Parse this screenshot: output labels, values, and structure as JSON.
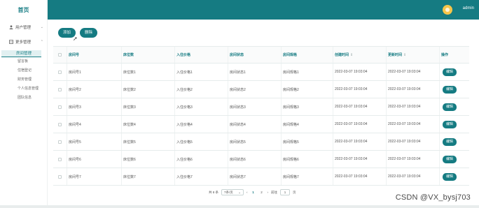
{
  "sidebar": {
    "brand": "首页",
    "groups": [
      {
        "label": "用户管理",
        "icon": "user-icon"
      },
      {
        "label": "更多管理",
        "icon": "grid-icon"
      }
    ],
    "active": "房间管理",
    "items": [
      "留言板",
      "住宿登记",
      "财务管理",
      "个人信息管理",
      "团队信息"
    ]
  },
  "header": {
    "username": "admin",
    "avatar_icon": "avatar-icon",
    "bg_color": "#157b82"
  },
  "toolbar": {
    "add_label": "添加",
    "delete_label": "删除"
  },
  "table": {
    "columns": [
      "房间号",
      "床位数",
      "入住价格",
      "房间状态",
      "房间规格",
      "创建时间",
      "更新时间",
      "操作"
    ],
    "edit_label": "编辑",
    "rows": [
      [
        "房间号1",
        "床位数1",
        "入住价格1",
        "房间状态1",
        "房间规格1",
        "2022-03-07 19:03:04",
        "2022-03-07 19:03:04"
      ],
      [
        "房间号2",
        "床位数2",
        "入住价格2",
        "房间状态2",
        "房间规格2",
        "2022-03-07 19:03:04",
        "2022-03-07 19:03:04"
      ],
      [
        "房间号3",
        "床位数3",
        "入住价格3",
        "房间状态3",
        "房间规格3",
        "2022-03-07 19:03:04",
        "2022-03-07 19:03:04"
      ],
      [
        "房间号4",
        "床位数4",
        "入住价格4",
        "房间状态4",
        "房间规格4",
        "2022-03-07 19:03:04",
        "2022-03-07 19:03:04"
      ],
      [
        "房间号5",
        "床位数5",
        "入住价格5",
        "房间状态5",
        "房间规格5",
        "2022-03-07 19:03:04",
        "2022-03-07 19:03:04"
      ],
      [
        "房间号6",
        "床位数6",
        "入住价格6",
        "房间状态6",
        "房间规格6",
        "2022-03-07 19:03:04",
        "2022-03-07 19:03:04"
      ],
      [
        "房间号7",
        "床位数7",
        "入住价格7",
        "房间状态7",
        "房间规格7",
        "2022-03-07 19:03:04",
        "2022-03-07 19:03:04"
      ]
    ]
  },
  "pagination": {
    "total_text": "共 8 条",
    "page_size": "7条/页",
    "pages": [
      "1",
      "2"
    ],
    "current": "1",
    "goto_label": "前往",
    "goto_value": "1",
    "page_suffix": "页"
  },
  "watermark": "CSDN @VX_bysj703"
}
